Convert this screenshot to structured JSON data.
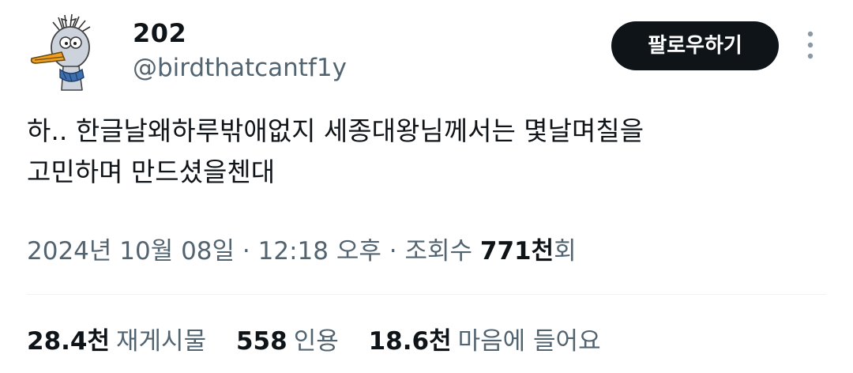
{
  "author": {
    "display_name": "202",
    "handle": "@birdthatcantf1y",
    "avatar_icon": "cartoon-bird-avatar"
  },
  "actions": {
    "follow_label": "팔로우하기",
    "more_icon": "more-vertical-icon"
  },
  "tweet": {
    "text": "하.. 한글날왜하루밖애없지 세종대왕님께서는 몇날며칠을\n고민하며 만드셨을첸대"
  },
  "meta": {
    "date": "2024년 10월 08일",
    "separator1": "·",
    "time": "12:18 오후",
    "separator2": "·",
    "views_label": "조회수",
    "views_count": "771천",
    "views_suffix": "회"
  },
  "stats": {
    "reposts_count": "28.4천",
    "reposts_label": "재게시물",
    "quotes_count": "558",
    "quotes_label": "인용",
    "likes_count": "18.6천",
    "likes_label": "마음에 들어요"
  },
  "colors": {
    "text_primary": "#0f1419",
    "text_secondary": "#536471",
    "button_bg": "#0f1419",
    "divider": "#eff3f4"
  }
}
